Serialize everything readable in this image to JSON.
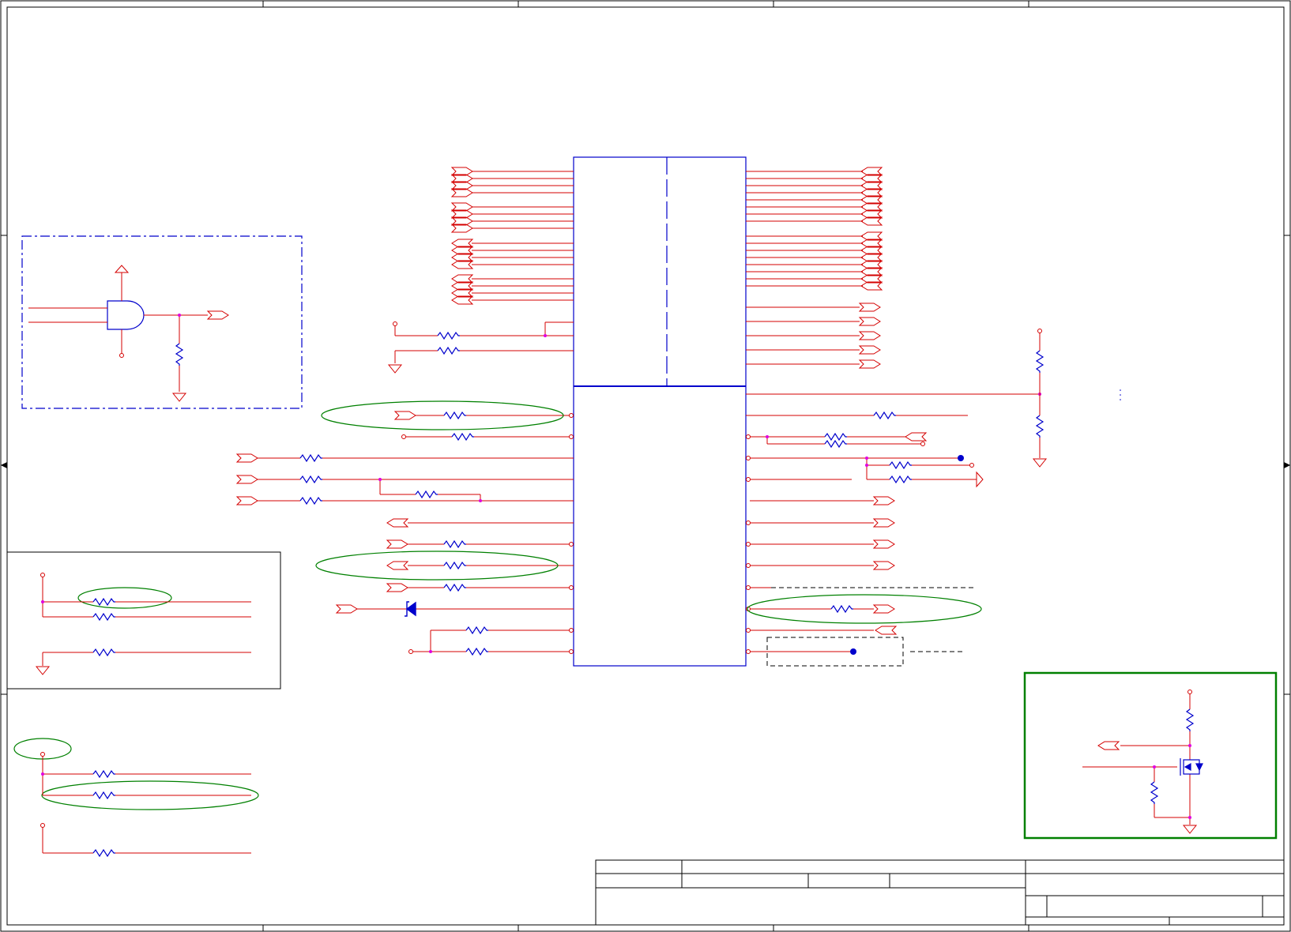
{
  "colors": {
    "wire": "#d40000",
    "symbol": "#0000cc",
    "junction": "#e000e0",
    "frame": "#000000",
    "highlight": "#008000",
    "background": "#ffffff"
  },
  "components": {
    "main_ic": {
      "kind": "integrated-circuit",
      "sections": 2
    },
    "and_gate": {
      "kind": "and-gate"
    },
    "mosfet": {
      "kind": "n-channel-mosfet"
    },
    "diode": {
      "kind": "schottky-diode"
    }
  },
  "title_block": {
    "kind": "title-block",
    "rows": 3
  }
}
